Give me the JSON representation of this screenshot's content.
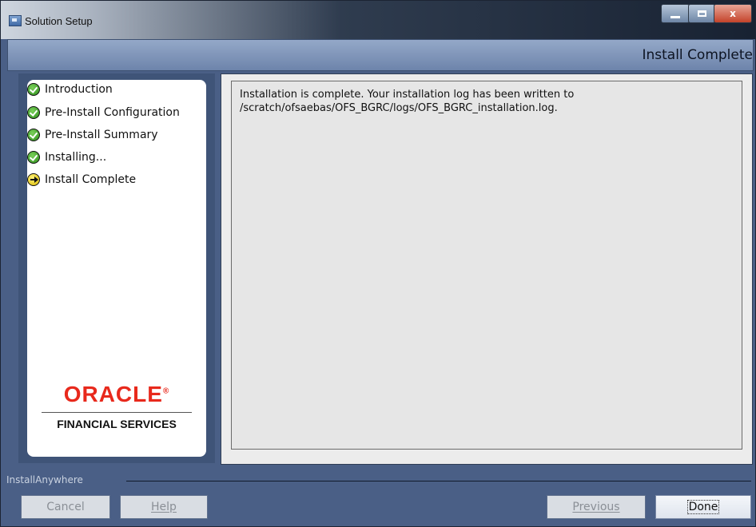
{
  "window": {
    "title": "Solution Setup",
    "controls": {
      "minimize_icon": "minimize-icon",
      "maximize_icon": "maximize-icon",
      "close_glyph": "x"
    }
  },
  "header": {
    "step_title": "Install Complete"
  },
  "sidebar": {
    "steps": [
      {
        "label": "Introduction",
        "status": "done",
        "icon": "check-circle-icon"
      },
      {
        "label": "Pre-Install Configuration",
        "status": "done",
        "icon": "check-circle-icon"
      },
      {
        "label": "Pre-Install Summary",
        "status": "done",
        "icon": "check-circle-icon"
      },
      {
        "label": "Installing...",
        "status": "done",
        "icon": "check-circle-icon"
      },
      {
        "label": "Install Complete",
        "status": "current",
        "icon": "arrow-circle-icon"
      }
    ],
    "logo": {
      "brand": "ORACLE",
      "trademark": "®",
      "tagline": "FINANCIAL SERVICES",
      "brand_color": "#e8291c"
    }
  },
  "main": {
    "message_line1": "Installation is complete.  Your installation log has been written to",
    "message_line2": "/scratch/ofsaebas/OFS_BGRC/logs/OFS_BGRC_installation.log."
  },
  "footer": {
    "vendor_label": "InstallAnywhere",
    "buttons": {
      "cancel": "Cancel",
      "help": "Help",
      "previous": "Previous",
      "done": "Done"
    }
  },
  "colors": {
    "window_bg": "#4a5f86",
    "header_bg": "#7c92b8",
    "content_bg": "#e6e6e6",
    "done_icon": "#2c8c1a",
    "current_icon": "#d8b800"
  }
}
